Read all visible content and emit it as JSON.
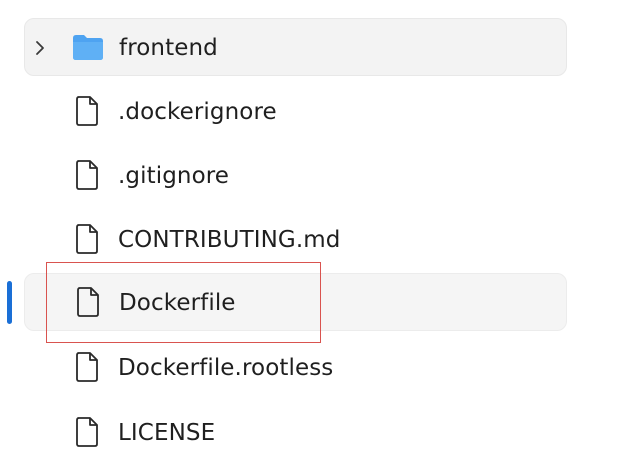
{
  "colors": {
    "accent": "#1a6fd6",
    "folder": "#4ea3f1",
    "highlight": "#d9534f",
    "icon_stroke": "#2a2a2a"
  },
  "tree": {
    "items": [
      {
        "type": "folder",
        "label": "frontend",
        "icon": "folder-icon",
        "expanded": false
      },
      {
        "type": "file",
        "label": ".dockerignore",
        "icon": "file-icon"
      },
      {
        "type": "file",
        "label": ".gitignore",
        "icon": "file-icon"
      },
      {
        "type": "file",
        "label": "CONTRIBUTING.md",
        "icon": "file-icon"
      },
      {
        "type": "file",
        "label": "Dockerfile",
        "icon": "file-icon",
        "selected": true
      },
      {
        "type": "file",
        "label": "Dockerfile.rootless",
        "icon": "file-icon"
      },
      {
        "type": "file",
        "label": "LICENSE",
        "icon": "file-icon"
      }
    ]
  }
}
